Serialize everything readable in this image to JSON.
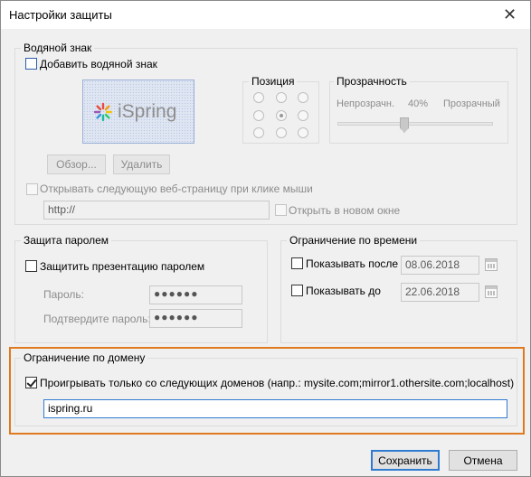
{
  "window": {
    "title": "Настройки защиты",
    "close_glyph": "✕"
  },
  "watermark": {
    "group_title": "Водяной знак",
    "add_label": "Добавить водяной знак",
    "add_checked": false,
    "logo_text": "iSpring",
    "browse_label": "Обзор...",
    "delete_label": "Удалить",
    "open_page_label": "Открывать следующую веб-страницу при клике мыши",
    "url_value": "http://",
    "new_window_label": "Открыть в новом окне",
    "position": {
      "title": "Позиция",
      "selected": "middle-center"
    },
    "transparency": {
      "title": "Прозрачность",
      "left_label": "Непрозрачн.",
      "value_label": "40%",
      "right_label": "Прозрачный",
      "value": 40
    }
  },
  "password": {
    "group_title": "Защита паролем",
    "protect_label": "Защитить презентацию паролем",
    "password_label": "Пароль:",
    "password_value": "●●●●●●",
    "confirm_label": "Подтвердите пароль:",
    "confirm_value": "●●●●●●"
  },
  "time_limit": {
    "group_title": "Ограничение по времени",
    "show_after_label": "Показывать после",
    "show_after_date": "08.06.2018",
    "show_until_label": "Показывать до",
    "show_until_date": "22.06.2018"
  },
  "domain": {
    "group_title": "Ограничение по домену",
    "play_only_label": "Проигрывать только со следующих доменов (напр.: mysite.com;mirror1.othersite.com;localhost)",
    "play_only_checked": true,
    "domains_value": "ispring.ru",
    "highlight_color": "#e07a1f"
  },
  "footer": {
    "save_label": "Сохранить",
    "cancel_label": "Отмена"
  }
}
